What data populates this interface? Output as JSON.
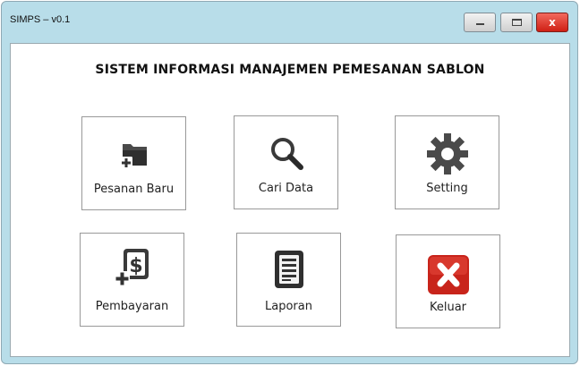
{
  "window": {
    "title": "SIMPS – v0.1",
    "close_glyph": "x"
  },
  "main": {
    "heading": "SISTEM INFORMASI MANAJEMEN PEMESANAN SABLON",
    "menu": [
      {
        "label": "Pesanan Baru",
        "icon": "folder-add-icon"
      },
      {
        "label": "Cari Data",
        "icon": "search-icon"
      },
      {
        "label": "Setting",
        "icon": "gear-icon"
      },
      {
        "label": "Pembayaran",
        "icon": "payment-add-icon"
      },
      {
        "label": "Laporan",
        "icon": "report-icon"
      },
      {
        "label": "Keluar",
        "icon": "exit-icon"
      }
    ]
  },
  "colors": {
    "title_bar": "#b8dde9",
    "close_button": "#d9261c",
    "icon_dark": "#404040"
  }
}
